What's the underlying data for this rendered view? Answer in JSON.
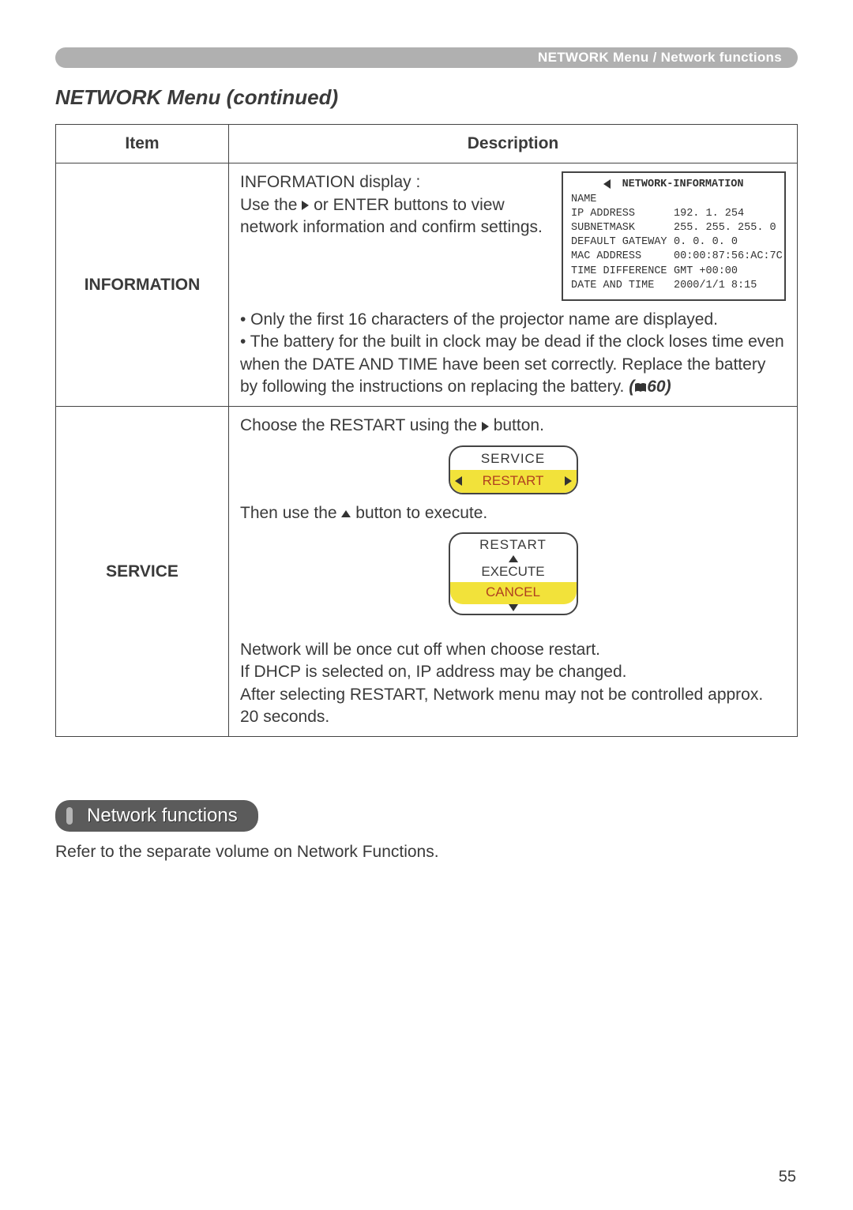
{
  "header": {
    "breadcrumb": "NETWORK Menu / Network functions"
  },
  "section_title": "NETWORK Menu (continued)",
  "table": {
    "head": {
      "item": "Item",
      "desc": "Description"
    },
    "rows": {
      "information": {
        "item": "INFORMATION",
        "lead_title": "INFORMATION display :",
        "lead_l1a": "Use the ",
        "lead_l1b": " or ENTER buttons to view",
        "lead_l2": "network information and confirm settings.",
        "panel": {
          "title": "NETWORK-INFORMATION",
          "rows": [
            {
              "k": "NAME",
              "v": ""
            },
            {
              "k": "IP ADDRESS",
              "v": "192. 1. 254"
            },
            {
              "k": "SUBNETMASK",
              "v": "255. 255. 255. 0"
            },
            {
              "k": "DEFAULT GATEWAY",
              "v": "0. 0. 0. 0"
            },
            {
              "k": "MAC ADDRESS",
              "v": "00:00:87:56:AC:7C"
            },
            {
              "k": "TIME DIFFERENCE",
              "v": "GMT +00:00"
            },
            {
              "k": "DATE AND TIME",
              "v": "2000/1/1  8:15"
            }
          ]
        },
        "b1": "• Only the first 16 characters of the projector name are displayed.",
        "b2": "• The battery for the built in clock may be dead if the clock loses time even when the DATE AND TIME have been set correctly. Replace the battery by following the instructions on replacing the battery. ",
        "ref": "60"
      },
      "service": {
        "item": "SERVICE",
        "l1a": "Choose the RESTART using the ",
        "l1b": " button.",
        "osd1": {
          "caption": "SERVICE",
          "selected": "RESTART"
        },
        "l2a": "Then use the ",
        "l2b": " button to execute.",
        "osd2": {
          "header": "RESTART",
          "execute": "EXECUTE",
          "cancel": "CANCEL"
        },
        "tail1": "Network will be once cut off when choose restart.",
        "tail2": "If DHCP is selected on, IP address may be changed.",
        "tail3": "After selecting RESTART, Network menu may not be controlled approx. 20 seconds."
      }
    }
  },
  "pill_label": "Network functions",
  "after_pill": "Refer to the separate volume on Network Functions.",
  "page_number": "55"
}
